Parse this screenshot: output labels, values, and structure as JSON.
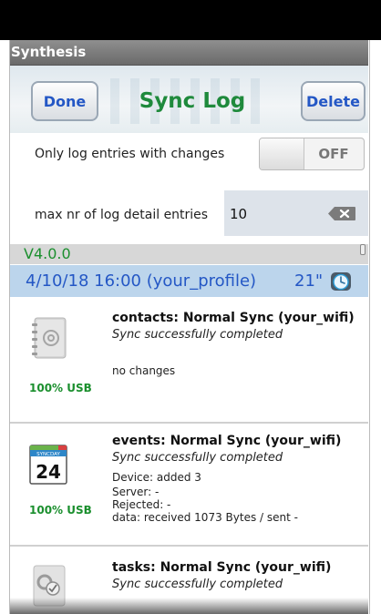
{
  "app": {
    "title": "Synthesis"
  },
  "header": {
    "done_label": "Done",
    "title": "Sync Log",
    "delete_label": "Delete"
  },
  "settings": {
    "only_changes_label": "Only log entries with changes",
    "only_changes_state": "OFF",
    "max_entries_label": "max nr of log detail entries",
    "max_entries_value": "10"
  },
  "version": "V4.0.0",
  "session": {
    "datetime": "4/10/18  16:00  (your_profile)",
    "duration": "21\""
  },
  "entries": [
    {
      "icon": "contacts-icon",
      "usb": "100% USB",
      "title": "contacts: Normal Sync  (your_wifi)",
      "status": "Sync successfully completed",
      "details": [
        "no changes"
      ]
    },
    {
      "icon": "calendar-icon",
      "calendar_label": "SYNCDAY",
      "calendar_day": "24",
      "usb": "100% USB",
      "title": "events: Normal Sync  (your_wifi)",
      "status": "Sync successfully completed",
      "details": [
        "Device: added 3",
        "Server: -",
        "Rejected: -",
        "data: received 1073 Bytes / sent -"
      ]
    },
    {
      "icon": "tasks-icon",
      "title": "tasks: Normal Sync  (your_wifi)",
      "status": "Sync successfully completed"
    }
  ],
  "colors": {
    "accent_green": "#1f8a3c",
    "accent_blue": "#2457c5",
    "session_bg": "#bcd5ec"
  }
}
